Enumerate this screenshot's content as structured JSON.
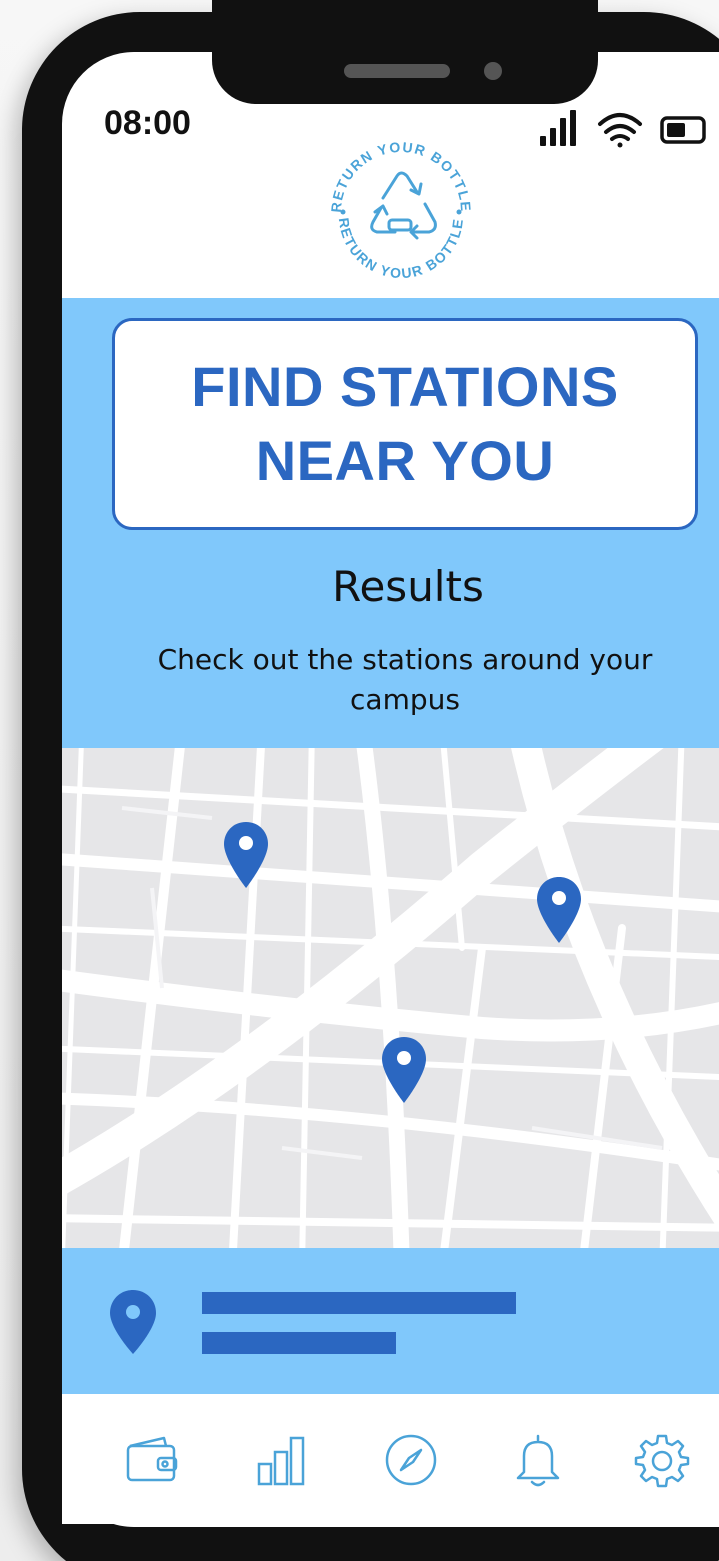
{
  "status_bar": {
    "time": "08:00",
    "signal_icon": "signal-bars-icon",
    "wifi_icon": "wifi-icon",
    "battery_icon": "battery-icon"
  },
  "logo": {
    "text_top": "RETURN YOUR BOTTLE",
    "text_bottom": "RETURN YOUR BOTTLE",
    "icon": "recycle-icon"
  },
  "hero": {
    "title_line1": "FIND STATIONS",
    "title_line2": "NEAR YOU",
    "results_heading": "Results",
    "results_sub": "Check out the stations around your campus"
  },
  "map": {
    "pins": [
      "location-pin-icon",
      "location-pin-icon",
      "location-pin-icon"
    ]
  },
  "selected_station": {
    "icon": "location-pin-icon"
  },
  "tab_bar": {
    "items": [
      "wallet-icon",
      "bar-chart-icon",
      "compass-icon",
      "bell-icon",
      "gear-icon"
    ]
  },
  "colors": {
    "accent": "#2b67c1",
    "light_blue": "#80c8fb",
    "map_bg": "#e6e6e8",
    "icon_outline": "#4aa3d8"
  }
}
